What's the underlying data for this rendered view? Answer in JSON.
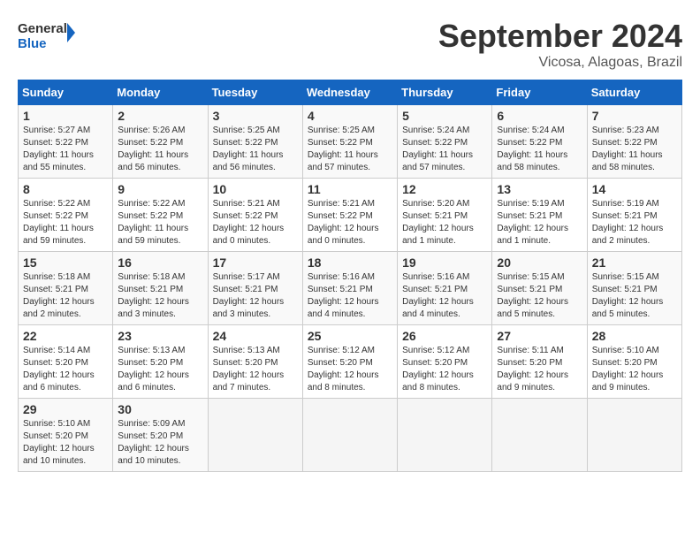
{
  "header": {
    "logo_line1": "General",
    "logo_line2": "Blue",
    "month": "September 2024",
    "location": "Vicosa, Alagoas, Brazil"
  },
  "weekdays": [
    "Sunday",
    "Monday",
    "Tuesday",
    "Wednesday",
    "Thursday",
    "Friday",
    "Saturday"
  ],
  "weeks": [
    [
      {
        "day": "1",
        "lines": [
          "Sunrise: 5:27 AM",
          "Sunset: 5:22 PM",
          "Daylight: 11 hours",
          "and 55 minutes."
        ]
      },
      {
        "day": "2",
        "lines": [
          "Sunrise: 5:26 AM",
          "Sunset: 5:22 PM",
          "Daylight: 11 hours",
          "and 56 minutes."
        ]
      },
      {
        "day": "3",
        "lines": [
          "Sunrise: 5:25 AM",
          "Sunset: 5:22 PM",
          "Daylight: 11 hours",
          "and 56 minutes."
        ]
      },
      {
        "day": "4",
        "lines": [
          "Sunrise: 5:25 AM",
          "Sunset: 5:22 PM",
          "Daylight: 11 hours",
          "and 57 minutes."
        ]
      },
      {
        "day": "5",
        "lines": [
          "Sunrise: 5:24 AM",
          "Sunset: 5:22 PM",
          "Daylight: 11 hours",
          "and 57 minutes."
        ]
      },
      {
        "day": "6",
        "lines": [
          "Sunrise: 5:24 AM",
          "Sunset: 5:22 PM",
          "Daylight: 11 hours",
          "and 58 minutes."
        ]
      },
      {
        "day": "7",
        "lines": [
          "Sunrise: 5:23 AM",
          "Sunset: 5:22 PM",
          "Daylight: 11 hours",
          "and 58 minutes."
        ]
      }
    ],
    [
      {
        "day": "8",
        "lines": [
          "Sunrise: 5:22 AM",
          "Sunset: 5:22 PM",
          "Daylight: 11 hours",
          "and 59 minutes."
        ]
      },
      {
        "day": "9",
        "lines": [
          "Sunrise: 5:22 AM",
          "Sunset: 5:22 PM",
          "Daylight: 11 hours",
          "and 59 minutes."
        ]
      },
      {
        "day": "10",
        "lines": [
          "Sunrise: 5:21 AM",
          "Sunset: 5:22 PM",
          "Daylight: 12 hours",
          "and 0 minutes."
        ]
      },
      {
        "day": "11",
        "lines": [
          "Sunrise: 5:21 AM",
          "Sunset: 5:22 PM",
          "Daylight: 12 hours",
          "and 0 minutes."
        ]
      },
      {
        "day": "12",
        "lines": [
          "Sunrise: 5:20 AM",
          "Sunset: 5:21 PM",
          "Daylight: 12 hours",
          "and 1 minute."
        ]
      },
      {
        "day": "13",
        "lines": [
          "Sunrise: 5:19 AM",
          "Sunset: 5:21 PM",
          "Daylight: 12 hours",
          "and 1 minute."
        ]
      },
      {
        "day": "14",
        "lines": [
          "Sunrise: 5:19 AM",
          "Sunset: 5:21 PM",
          "Daylight: 12 hours",
          "and 2 minutes."
        ]
      }
    ],
    [
      {
        "day": "15",
        "lines": [
          "Sunrise: 5:18 AM",
          "Sunset: 5:21 PM",
          "Daylight: 12 hours",
          "and 2 minutes."
        ]
      },
      {
        "day": "16",
        "lines": [
          "Sunrise: 5:18 AM",
          "Sunset: 5:21 PM",
          "Daylight: 12 hours",
          "and 3 minutes."
        ]
      },
      {
        "day": "17",
        "lines": [
          "Sunrise: 5:17 AM",
          "Sunset: 5:21 PM",
          "Daylight: 12 hours",
          "and 3 minutes."
        ]
      },
      {
        "day": "18",
        "lines": [
          "Sunrise: 5:16 AM",
          "Sunset: 5:21 PM",
          "Daylight: 12 hours",
          "and 4 minutes."
        ]
      },
      {
        "day": "19",
        "lines": [
          "Sunrise: 5:16 AM",
          "Sunset: 5:21 PM",
          "Daylight: 12 hours",
          "and 4 minutes."
        ]
      },
      {
        "day": "20",
        "lines": [
          "Sunrise: 5:15 AM",
          "Sunset: 5:21 PM",
          "Daylight: 12 hours",
          "and 5 minutes."
        ]
      },
      {
        "day": "21",
        "lines": [
          "Sunrise: 5:15 AM",
          "Sunset: 5:21 PM",
          "Daylight: 12 hours",
          "and 5 minutes."
        ]
      }
    ],
    [
      {
        "day": "22",
        "lines": [
          "Sunrise: 5:14 AM",
          "Sunset: 5:20 PM",
          "Daylight: 12 hours",
          "and 6 minutes."
        ]
      },
      {
        "day": "23",
        "lines": [
          "Sunrise: 5:13 AM",
          "Sunset: 5:20 PM",
          "Daylight: 12 hours",
          "and 6 minutes."
        ]
      },
      {
        "day": "24",
        "lines": [
          "Sunrise: 5:13 AM",
          "Sunset: 5:20 PM",
          "Daylight: 12 hours",
          "and 7 minutes."
        ]
      },
      {
        "day": "25",
        "lines": [
          "Sunrise: 5:12 AM",
          "Sunset: 5:20 PM",
          "Daylight: 12 hours",
          "and 8 minutes."
        ]
      },
      {
        "day": "26",
        "lines": [
          "Sunrise: 5:12 AM",
          "Sunset: 5:20 PM",
          "Daylight: 12 hours",
          "and 8 minutes."
        ]
      },
      {
        "day": "27",
        "lines": [
          "Sunrise: 5:11 AM",
          "Sunset: 5:20 PM",
          "Daylight: 12 hours",
          "and 9 minutes."
        ]
      },
      {
        "day": "28",
        "lines": [
          "Sunrise: 5:10 AM",
          "Sunset: 5:20 PM",
          "Daylight: 12 hours",
          "and 9 minutes."
        ]
      }
    ],
    [
      {
        "day": "29",
        "lines": [
          "Sunrise: 5:10 AM",
          "Sunset: 5:20 PM",
          "Daylight: 12 hours",
          "and 10 minutes."
        ]
      },
      {
        "day": "30",
        "lines": [
          "Sunrise: 5:09 AM",
          "Sunset: 5:20 PM",
          "Daylight: 12 hours",
          "and 10 minutes."
        ]
      },
      {
        "day": "",
        "lines": []
      },
      {
        "day": "",
        "lines": []
      },
      {
        "day": "",
        "lines": []
      },
      {
        "day": "",
        "lines": []
      },
      {
        "day": "",
        "lines": []
      }
    ]
  ]
}
